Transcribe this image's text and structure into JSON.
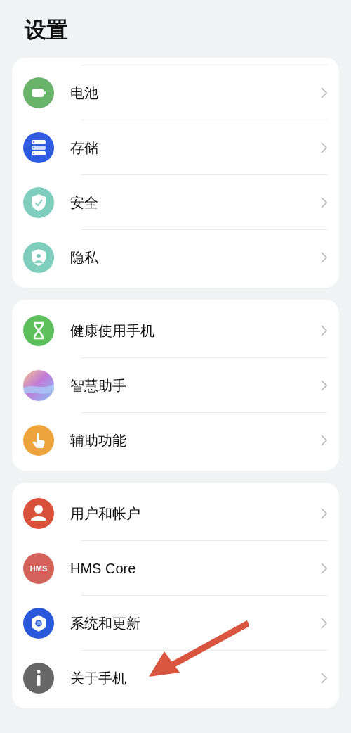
{
  "title": "设置",
  "groups": [
    {
      "top_divider": true,
      "items": [
        {
          "kind": "battery",
          "label": "电池"
        },
        {
          "kind": "storage",
          "label": "存储"
        },
        {
          "kind": "security",
          "label": "安全"
        },
        {
          "kind": "privacy",
          "label": "隐私"
        }
      ]
    },
    {
      "top_divider": false,
      "items": [
        {
          "kind": "wellbeing",
          "label": "健康使用手机"
        },
        {
          "kind": "assistant",
          "label": "智慧助手"
        },
        {
          "kind": "accessibility",
          "label": "辅助功能"
        }
      ]
    },
    {
      "top_divider": false,
      "items": [
        {
          "kind": "users",
          "label": "用户和帐户"
        },
        {
          "kind": "hms",
          "label": "HMS Core",
          "icon_text": "HMS"
        },
        {
          "kind": "system",
          "label": "系统和更新"
        },
        {
          "kind": "about",
          "label": "关于手机"
        }
      ]
    }
  ]
}
